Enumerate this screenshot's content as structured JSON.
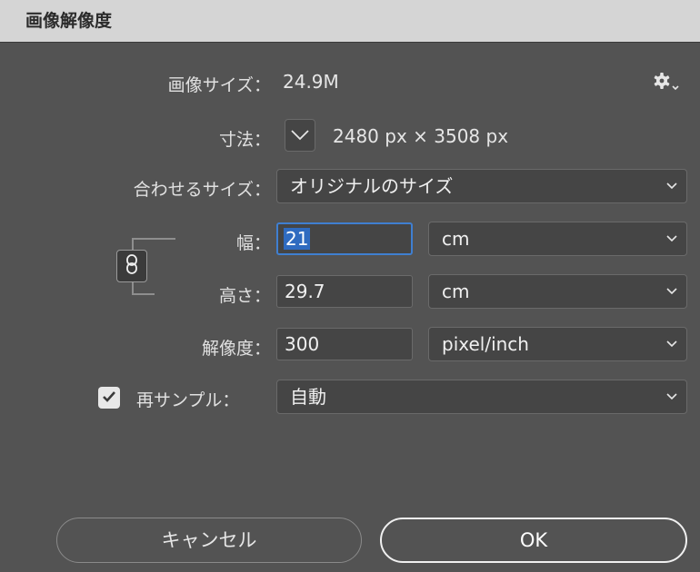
{
  "window": {
    "title": "画像解像度"
  },
  "image_size": {
    "label": "画像サイズ：",
    "value": "24.9M"
  },
  "dimensions": {
    "label": "寸法：",
    "value": "2480 px × 3508 px"
  },
  "fit_to": {
    "label": "合わせるサイズ：",
    "value": "オリジナルのサイズ"
  },
  "width": {
    "label": "幅：",
    "value": "21",
    "unit": "cm"
  },
  "height": {
    "label": "高さ：",
    "value": "29.7",
    "unit": "cm"
  },
  "resolution": {
    "label": "解像度：",
    "value": "300",
    "unit": "pixel/inch"
  },
  "resample": {
    "label": "再サンプル：",
    "checked": true,
    "value": "自動"
  },
  "buttons": {
    "cancel": "キャンセル",
    "ok": "OK"
  },
  "icons": {
    "gear": "gear-icon",
    "dimensions_toggle": "chevron-down-icon",
    "constrain": "link-icon",
    "checkbox": "checkmark-icon",
    "dropdown": "chevron-down-icon"
  },
  "colors": {
    "background": "#535353",
    "titlebar": "#d5d5d5",
    "field": "#454545",
    "focus": "#3f7fd1",
    "selection": "#2f6bc0"
  }
}
